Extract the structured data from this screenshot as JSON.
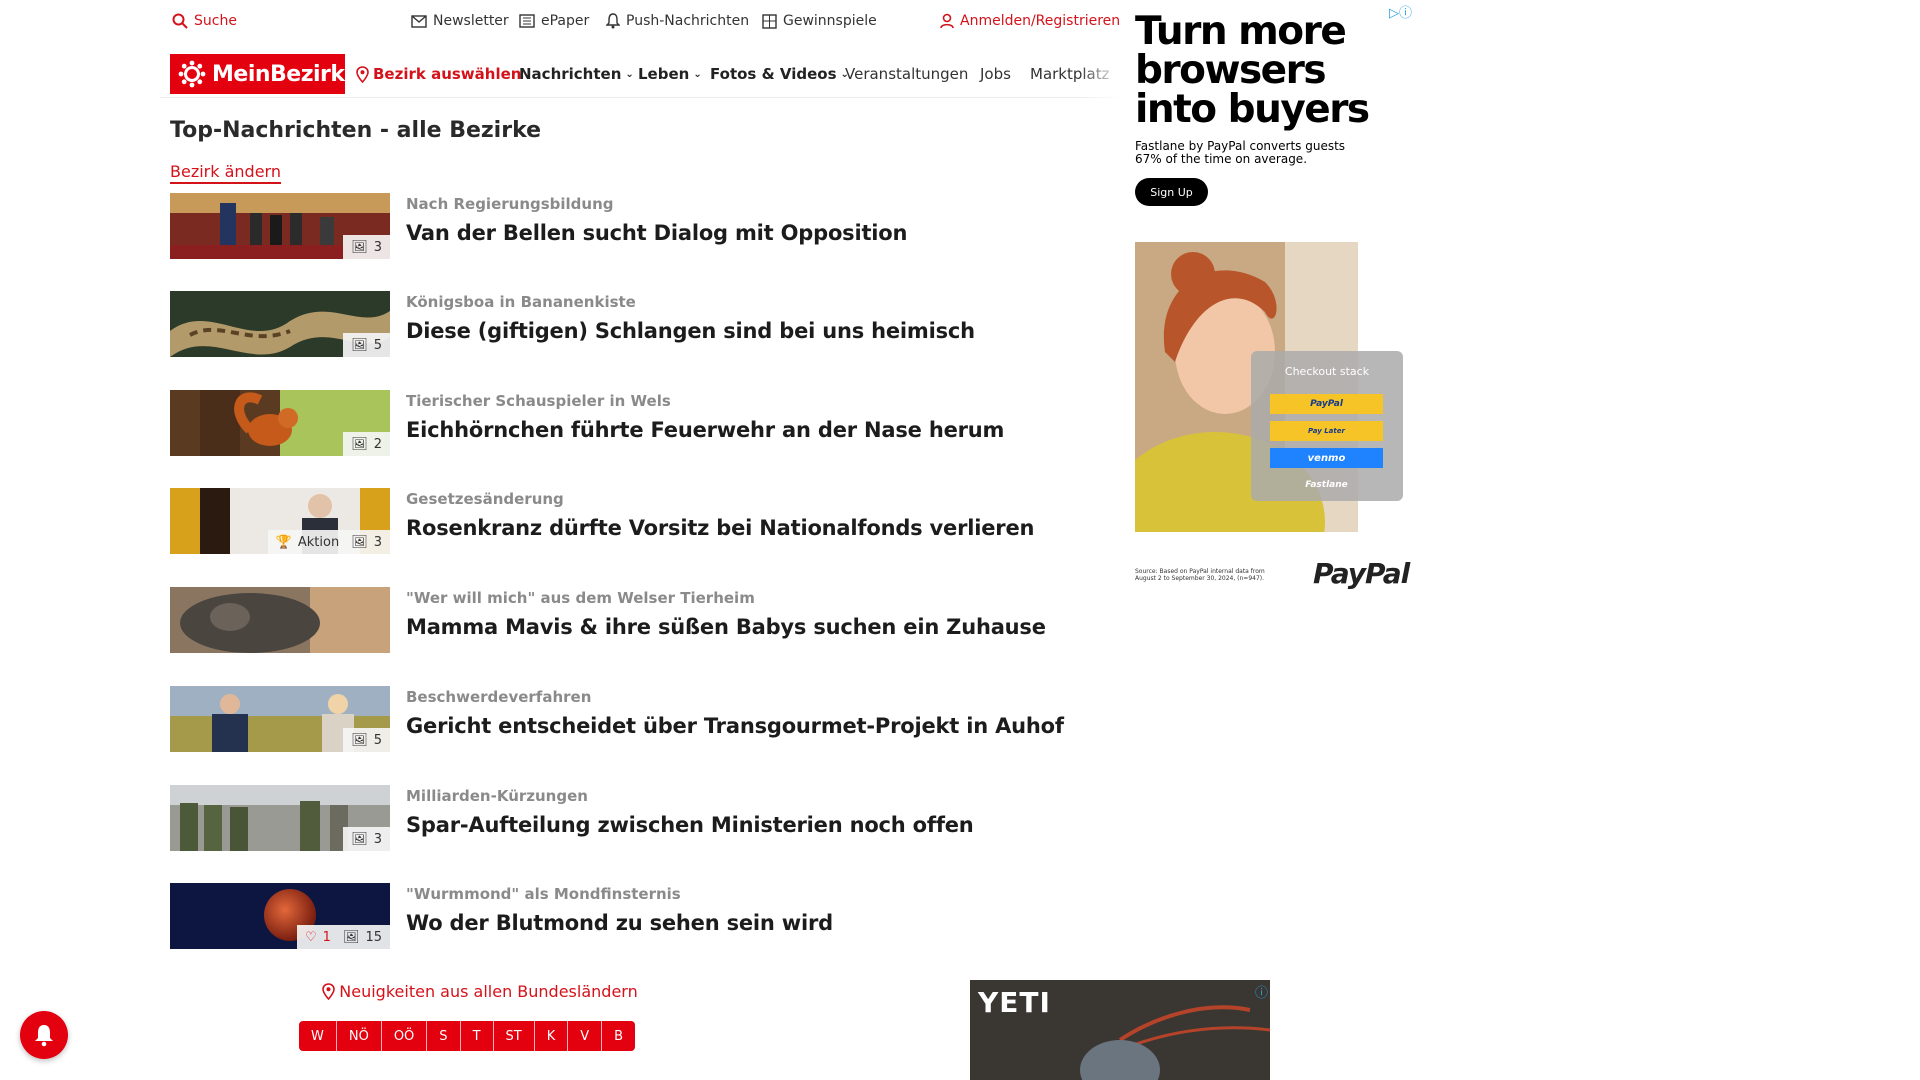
{
  "topbar": {
    "search": "Suche",
    "newsletter": "Newsletter",
    "epaper": "ePaper",
    "push": "Push-Nachrichten",
    "contests": "Gewinnspiele",
    "login": "Anmelden/Registrieren"
  },
  "nav": {
    "logo": "MeinBezirk",
    "select_district": "Bezirk auswählen",
    "news": "Nachrichten",
    "life": "Leben",
    "photos": "Fotos & Videos",
    "events": "Veranstaltungen",
    "jobs": "Jobs",
    "market": "Marktplatz"
  },
  "page": {
    "title": "Top-Nachrichten - alle Bezirke",
    "change_district": "Bezirk ändern"
  },
  "articles": [
    {
      "kicker": "Nach Regierungsbildung",
      "headline": "Van der Bellen sucht Dialog mit Opposition",
      "images": "3",
      "image": "press-room-photo"
    },
    {
      "kicker": "Königsboa in Bananenkiste",
      "headline": "Diese (giftigen) Schlangen sind bei uns heimisch",
      "images": "5",
      "image": "snake-photo"
    },
    {
      "kicker": "Tierischer Schauspieler in Wels",
      "headline": "Eichhörnchen führte Feuerwehr an der Nase herum",
      "images": "2",
      "image": "squirrel-photo"
    },
    {
      "kicker": "Gesetzesänderung",
      "headline": "Rosenkranz dürfte Vorsitz bei Nationalfonds verlieren",
      "images": "3",
      "aktion": "Aktion",
      "image": "politician-photo"
    },
    {
      "kicker": "\"Wer will mich\" aus dem Welser Tierheim",
      "headline": "Mamma Mavis & ihre süßen Babys suchen ein Zuhause",
      "image": "cat-photo"
    },
    {
      "kicker": "Beschwerdeverfahren",
      "headline": "Gericht entscheidet über Transgourmet-Projekt in Auhof",
      "images": "5",
      "image": "two-people-photo"
    },
    {
      "kicker": "Milliarden-Kürzungen",
      "headline": "Spar-Aufteilung zwischen Ministerien noch offen",
      "images": "3",
      "image": "soldiers-photo"
    },
    {
      "kicker": "\"Wurmmond\" als Mondfinsternis",
      "headline": "Wo der Blutmond zu sehen sein wird",
      "images": "15",
      "likes": "1",
      "image": "blood-moon-photo"
    }
  ],
  "states": {
    "link": "Neuigkeiten aus allen Bundesländern",
    "items": [
      "W",
      "NÖ",
      "OÖ",
      "S",
      "T",
      "ST",
      "K",
      "V",
      "B"
    ]
  },
  "ads": {
    "yeti_brand": "YETI",
    "paypal_headline": "Turn more browsers into buyers",
    "paypal_sub": "Fastlane by PayPal converts guests 67% of the time on average.",
    "paypal_cta": "Sign Up",
    "checkout_title": "Checkout stack",
    "checkout_buttons": [
      "PayPal",
      "Pay Later",
      "venmo",
      "Fastlane"
    ],
    "source": "Source: Based on PayPal internal data from August 2 to September 30, 2024, (n=947).",
    "paypal_logo": "PayPal"
  },
  "colors": {
    "brand": "#e3000f",
    "link": "#d4121a"
  }
}
